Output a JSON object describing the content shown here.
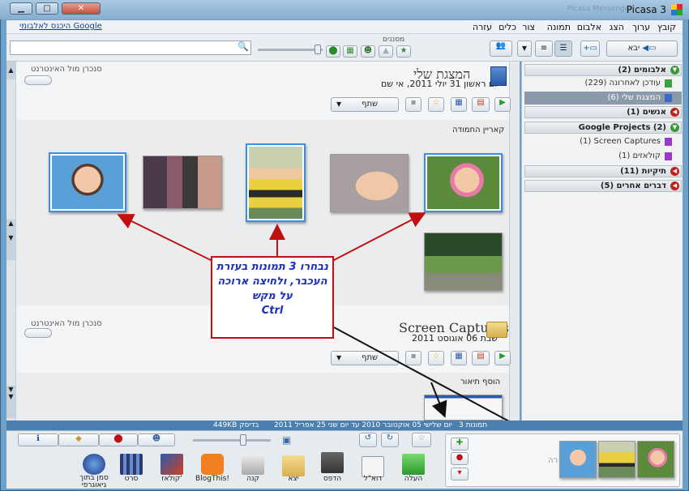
{
  "window": {
    "title": "Picasa 3",
    "controls": [
      "minimize",
      "maximize",
      "close"
    ],
    "ghost_text": "Picasa Messenger"
  },
  "menu": [
    "קובץ",
    "ערוך",
    "הצג",
    "אלבום",
    "תמונה",
    "צור",
    "כלים",
    "עזרה"
  ],
  "menu_link": "היכנס לאלבומי Google",
  "toolbar": {
    "import_label": "יבא",
    "filters_label": "מסננים",
    "search_placeholder": ""
  },
  "sidebar": {
    "categories": [
      {
        "label": "אלבומים (2)",
        "open": true
      },
      {
        "label": "אנשים (1)",
        "open": false
      },
      {
        "label": "Google Projects (2)",
        "open": true
      },
      {
        "label": "תיקיות (11)",
        "open": false
      },
      {
        "label": "דברים אחרים (5)",
        "open": false
      }
    ],
    "albums": [
      {
        "label": "עודכן לאחרונה (229)",
        "selected": false
      },
      {
        "label": "המצגת שלי (6)",
        "selected": true
      }
    ],
    "projects": [
      {
        "label": "(1) Screen Captures"
      },
      {
        "label": "קולאזים (1)"
      }
    ]
  },
  "album1": {
    "title": "המצגת שלי",
    "date": "יום ראשון 31 יולי 2011, אי שם",
    "sync": "סנכרן מול האינטרנט",
    "share": "שתף",
    "subtitle": "קאריין החמודה"
  },
  "album2": {
    "title": "Screen Captures",
    "date": "שבת 06 אוגוסט 2011",
    "sync": "סנכרן מול האינטרנט",
    "share": "שתף",
    "add_desc": "הוסף תיאור"
  },
  "callout": {
    "line1": "נבחרו 3 תמונות בעזרת",
    "line2": "העכבר, ולחיצה ארוכה",
    "line3": "על מקש",
    "line4": "Ctrl"
  },
  "status": {
    "count": "3 תמונות",
    "dates": "יום שלישי 05 אוקטובר 2010 עד יום שני 25 אפריל 2011",
    "size": "449KB בדיסק"
  },
  "bottom_actions": [
    {
      "label": "העלה",
      "icon": "upload-icon"
    },
    {
      "label": "דוא\"ל",
      "icon": "email-icon"
    },
    {
      "label": "הדפס",
      "icon": "print-icon"
    },
    {
      "label": "יצא",
      "icon": "export-icon"
    },
    {
      "label": "קנה",
      "icon": "shop-icon"
    },
    {
      "label": "BlogThis!",
      "icon": "blogger-icon"
    },
    {
      "label": "קולאז'",
      "icon": "collage-icon"
    },
    {
      "label": "סרט",
      "icon": "movie-icon"
    },
    {
      "label": "סמן בתוך גיאוגרפי",
      "icon": "earth-icon"
    }
  ],
  "tray_hint": "רה",
  "colors": {
    "accent": "#3a8fe0",
    "callout_border": "#c01010",
    "callout_text": "#1a2ec0",
    "status_bar": "#4a7fb0"
  }
}
